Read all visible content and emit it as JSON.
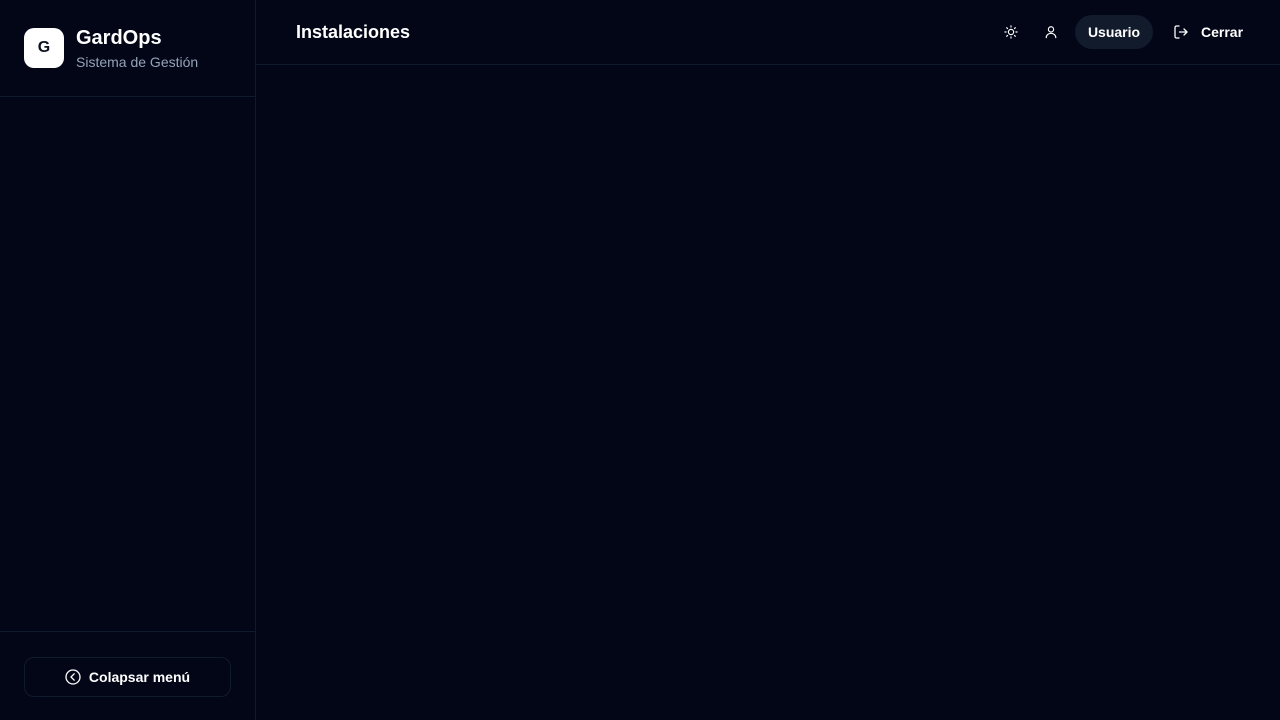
{
  "brand": {
    "logo_letter": "G",
    "name": "GardOps",
    "subtitle": "Sistema de Gestión"
  },
  "header": {
    "title": "Instalaciones",
    "theme_icon": "sun-icon",
    "user_icon": "user-icon",
    "user_label": "Usuario",
    "logout_icon": "logout-icon",
    "logout_label": "Cerrar"
  },
  "sidebar": {
    "collapse_icon": "chevron-left-circle-icon",
    "collapse_label": "Colapsar menú"
  },
  "colors": {
    "background": "#020617",
    "border": "#0f1a2e",
    "muted_text": "#94a3b8",
    "pill_bg": "#111b2c"
  }
}
